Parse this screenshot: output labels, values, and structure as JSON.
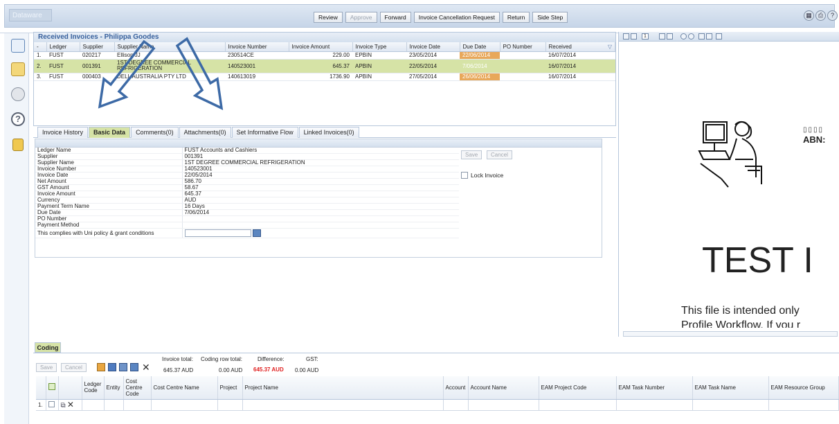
{
  "app": {
    "logo_text": "Dataware"
  },
  "toolbar": {
    "buttons": [
      {
        "label": "Review",
        "enabled": true
      },
      {
        "label": "Approve",
        "enabled": false
      },
      {
        "label": "Forward",
        "enabled": true
      },
      {
        "label": "Invoice Cancellation Request",
        "enabled": true
      },
      {
        "label": "Return",
        "enabled": true
      },
      {
        "label": "Side Step",
        "enabled": true
      }
    ],
    "right_icons": [
      "grid-icon",
      "print-icon",
      "help-icon"
    ]
  },
  "sidebar": {
    "icons": [
      "invoice-list-icon",
      "inbox-icon",
      "settings-icon",
      "help-icon",
      "key-icon"
    ]
  },
  "received": {
    "title": "Received Invoices - Philippa Goodes",
    "columns": [
      "-",
      "Ledger",
      "Supplier",
      "Supplier Name",
      "Invoice Number",
      "Invoice Amount",
      "Invoice Type",
      "Invoice Date",
      "Due Date",
      "PO Number",
      "Received"
    ],
    "rows": [
      {
        "n": "1.",
        "ledger": "FUST",
        "supplier": "020217",
        "name": "Ellison JJ",
        "inv": "230514CE",
        "amount": "229.00",
        "type": "EPBIN",
        "date": "23/05/2014",
        "due": "22/06/2014",
        "po": "",
        "received": "16/07/2014",
        "selected": false
      },
      {
        "n": "2.",
        "ledger": "FUST",
        "supplier": "001391",
        "name": "1ST DEGREE COMMERCIAL REFRIGERATION",
        "inv": "140523001",
        "amount": "645.37",
        "type": "APBIN",
        "date": "22/05/2014",
        "due": "7/06/2014",
        "po": "",
        "received": "16/07/2014",
        "selected": true
      },
      {
        "n": "3.",
        "ledger": "FUST",
        "supplier": "000403",
        "name": "DELL AUSTRALIA PTY LTD",
        "inv": "140613019",
        "amount": "1736.90",
        "type": "APBIN",
        "date": "27/05/2014",
        "due": "26/06/2014",
        "po": "",
        "received": "16/07/2014",
        "selected": false
      }
    ]
  },
  "tabs": [
    {
      "label": "Invoice History",
      "active": false
    },
    {
      "label": "Basic Data",
      "active": true
    },
    {
      "label": "Comments(0)",
      "active": false
    },
    {
      "label": "Attachments(0)",
      "active": false
    },
    {
      "label": "Set Informative Flow",
      "active": false
    },
    {
      "label": "Linked Invoices(0)",
      "active": false
    }
  ],
  "basic_data": [
    {
      "k": "Ledger Name",
      "v": "FUST Accounts and Cashiers"
    },
    {
      "k": "Supplier",
      "v": "001391"
    },
    {
      "k": "Supplier Name",
      "v": "1ST DEGREE COMMERCIAL REFRIGERATION"
    },
    {
      "k": "Invoice Number",
      "v": "140523001"
    },
    {
      "k": "Invoice Date",
      "v": "22/05/2014"
    },
    {
      "k": "Net Amount",
      "v": "586.70"
    },
    {
      "k": "GST Amount",
      "v": "58.67"
    },
    {
      "k": "Invoice Amount",
      "v": "645.37"
    },
    {
      "k": "Currency",
      "v": "AUD"
    },
    {
      "k": "Payment Term Name",
      "v": "16 Days"
    },
    {
      "k": "Due Date",
      "v": "7/06/2014"
    },
    {
      "k": "PO Number",
      "v": ""
    },
    {
      "k": "Payment Method",
      "v": ""
    },
    {
      "k": "This complies with Uni policy & grant conditions",
      "v": ""
    }
  ],
  "basic_buttons": {
    "save": "Save",
    "cancel": "Cancel",
    "lock": "Lock Invoice"
  },
  "preview": {
    "abn": "ABN:",
    "title": "TEST I",
    "line1": "This file is intended only",
    "line2": "Profile Workflow. If you r",
    "page": "1"
  },
  "coding": {
    "tab": "Coding",
    "save": "Save",
    "cancel": "Cancel",
    "invoice_total_label": "Invoice total:",
    "invoice_total": "645.37 AUD",
    "row_total_label": "Coding row total:",
    "row_total": "0.00 AUD",
    "difference_label": "Difference:",
    "difference": "645.37 AUD",
    "gst_label": "GST:",
    "gst": "0.00 AUD",
    "columns": [
      "Ledger Code",
      "Entity",
      "Cost Centre Code",
      "Cost Centre Name",
      "Project",
      "Project Name",
      "Account",
      "Account Name",
      "EAM Project Code",
      "EAM Task Number",
      "EAM Task Name",
      "EAM Resource Group"
    ],
    "row_number": "1."
  },
  "colors": {
    "header_bg": "#d4e0ee",
    "selected_row": "#d6e3a6",
    "due_highlight": "#e8a85a",
    "arrow": "#3d6aa6",
    "difference_red": "#e02020"
  }
}
